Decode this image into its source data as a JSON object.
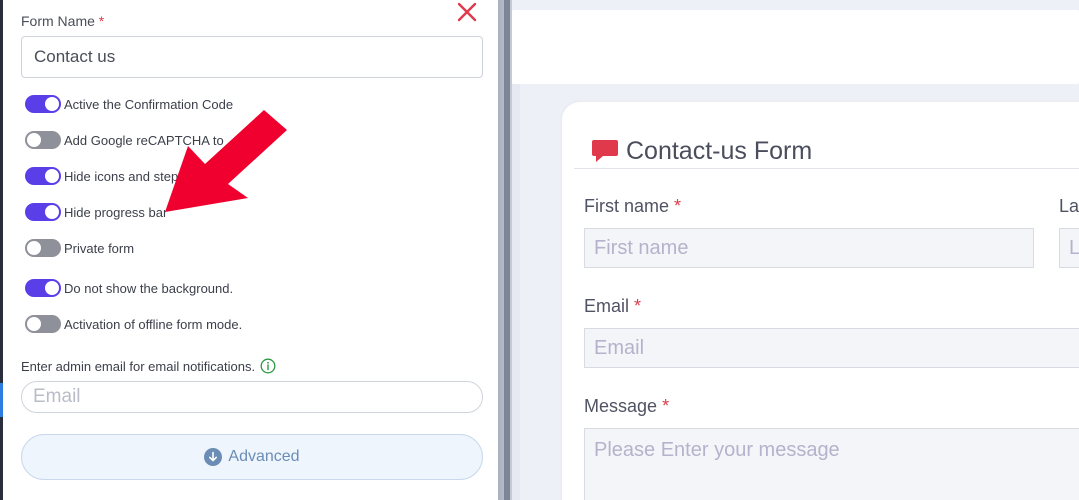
{
  "settings_panel": {
    "form_name_label": "Form Name",
    "required_mark": "*",
    "form_name_value": "Contact us",
    "toggles": [
      {
        "label": "Active the Confirmation Code",
        "on": true
      },
      {
        "label": "Add Google reCAPTCHA to",
        "on": false
      },
      {
        "label": "Hide icons and step",
        "on": true
      },
      {
        "label": "Hide progress bar",
        "on": true
      },
      {
        "label": "Private form",
        "on": false
      },
      {
        "label": "Do not show the background.",
        "on": true
      },
      {
        "label": "Activation of offline form mode.",
        "on": false
      }
    ],
    "admin_email_label": "Enter admin email for email notifications.",
    "admin_email_placeholder": "Email",
    "advanced_label": "Advanced",
    "icons": {
      "close": "close-icon",
      "info": "info-icon",
      "advanced": "arrow-down-circle-icon",
      "annotation": "red-arrow"
    },
    "colors": {
      "toggle_on": "#5a3ee8",
      "toggle_off": "#8e909a",
      "close": "#e0394b",
      "annotation_arrow": "#f0002e"
    }
  },
  "form_preview": {
    "title": "Contact-us Form",
    "title_icon": "chat-bubble-icon",
    "fields": {
      "first_name": {
        "label": "First name",
        "required": "*",
        "placeholder": "First name"
      },
      "last_name": {
        "label": "La",
        "placeholder": "L"
      },
      "email": {
        "label": "Email",
        "required": "*",
        "placeholder": "Email"
      },
      "message": {
        "label": "Message",
        "required": "*",
        "placeholder": "Please Enter your message"
      }
    },
    "colors": {
      "title_icon": "#e0394b",
      "required": "#e0394b"
    }
  }
}
